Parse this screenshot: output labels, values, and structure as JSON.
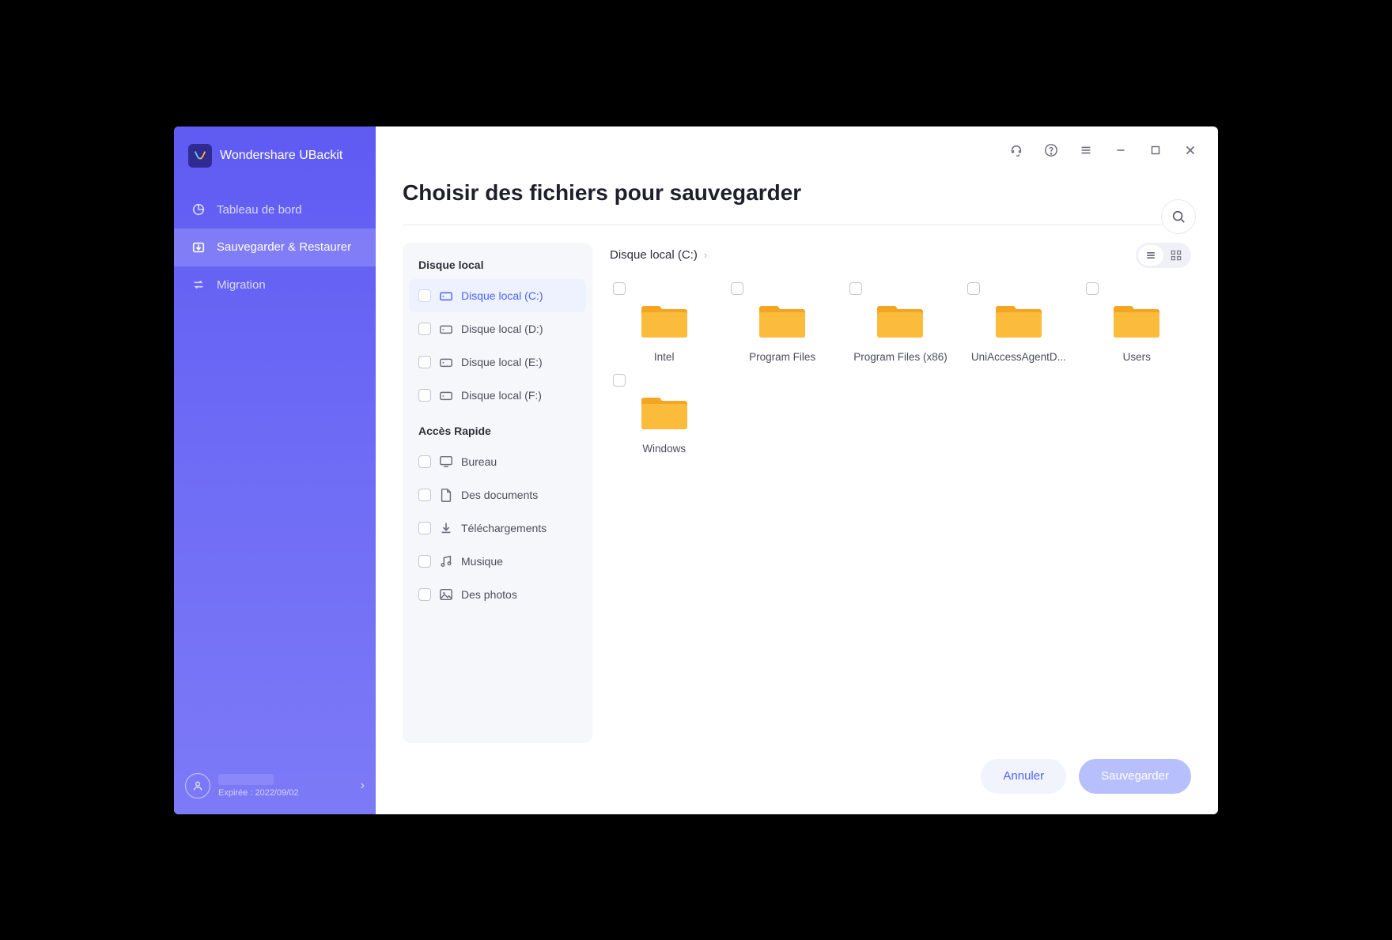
{
  "brand": "Wondershare UBackit",
  "nav": {
    "dashboard": "Tableau de bord",
    "backup": "Sauvegarder & Restaurer",
    "migration": "Migration"
  },
  "account": {
    "expiry": "Expirée : 2022/09/02"
  },
  "header": {
    "title": "Choisir des fichiers pour sauvegarder"
  },
  "sourcePanel": {
    "disksHeading": "Disque local",
    "disks": [
      {
        "label": "Disque local (C:)",
        "active": true
      },
      {
        "label": "Disque local (D:)"
      },
      {
        "label": "Disque local (E:)"
      },
      {
        "label": "Disque local (F:)"
      }
    ],
    "quickHeading": "Accès Rapide",
    "quick": [
      {
        "label": "Bureau",
        "icon": "monitor"
      },
      {
        "label": "Des documents",
        "icon": "document"
      },
      {
        "label": "Téléchargements",
        "icon": "download"
      },
      {
        "label": "Musique",
        "icon": "music"
      },
      {
        "label": "Des photos",
        "icon": "image"
      }
    ]
  },
  "browser": {
    "breadcrumb": "Disque local (C:)",
    "folders": [
      "Intel",
      "Program Files",
      "Program Files (x86)",
      "UniAccessAgentD...",
      "Users",
      "Windows"
    ]
  },
  "actions": {
    "cancel": "Annuler",
    "save": "Sauvegarder"
  }
}
